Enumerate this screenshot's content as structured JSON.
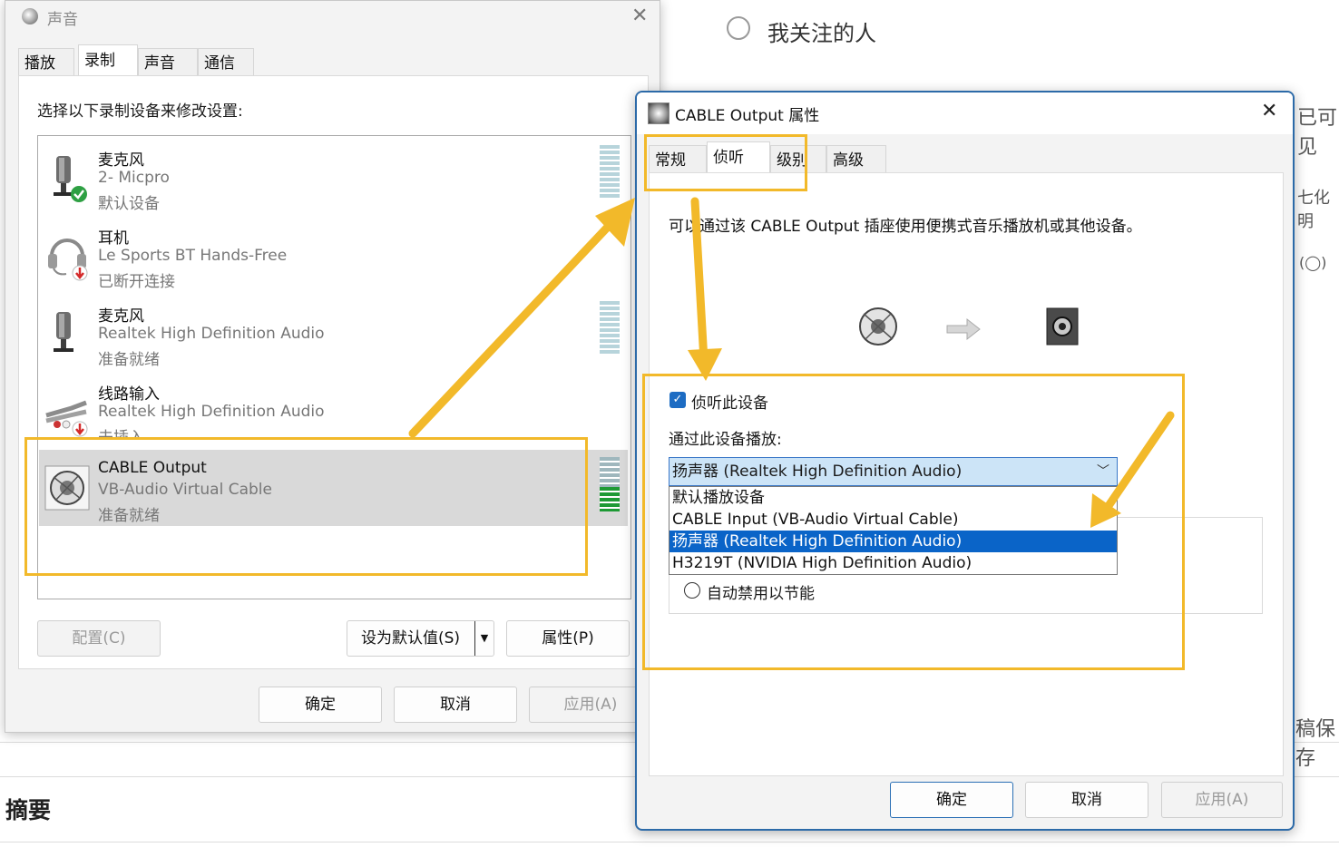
{
  "background": {
    "follow_label": "我关注的人",
    "right_fragments": [
      "已可见",
      "七化明",
      "(◯)",
      "稿保存"
    ],
    "summary_heading": "摘要"
  },
  "sound_dialog": {
    "title": "声音",
    "tabs": [
      "播放",
      "录制",
      "声音",
      "通信"
    ],
    "active_tab": "录制",
    "instruction": "选择以下录制设备来修改设置:",
    "devices": [
      {
        "name": "麦克风",
        "sub": "2- Micpro",
        "status": "默认设备",
        "icon": "microphone-icon",
        "badge": "default-check-badge"
      },
      {
        "name": "耳机",
        "sub": "Le Sports BT Hands-Free",
        "status": "已断开连接",
        "icon": "headset-icon",
        "badge": "disconnected-badge"
      },
      {
        "name": "麦克风",
        "sub": "Realtek High Definition Audio",
        "status": "准备就绪",
        "icon": "microphone-icon"
      },
      {
        "name": "线路输入",
        "sub": "Realtek High Definition Audio",
        "status": "未插入",
        "icon": "line-in-cable-icon",
        "badge": "unplugged-badge"
      },
      {
        "name": "CABLE Output",
        "sub": "VB-Audio Virtual Cable",
        "status": "准备就绪",
        "icon": "speaker-cable-icon",
        "level": 0.45
      }
    ],
    "buttons": {
      "configure": "配置(C)",
      "set_default": "设为默认值(S)",
      "properties": "属性(P)",
      "ok": "确定",
      "cancel": "取消",
      "apply": "应用(A)"
    }
  },
  "properties_dialog": {
    "title": "CABLE Output 属性",
    "tabs": [
      "常规",
      "侦听",
      "级别",
      "高级"
    ],
    "active_tab": "侦听",
    "description": "可以通过该 CABLE Output 插座使用便携式音乐播放机或其他设备。",
    "listen_checkbox": {
      "label": "侦听此设备",
      "checked": true
    },
    "playthrough_label": "通过此设备播放:",
    "selected_device": "扬声器 (Realtek High Definition Audio)",
    "dropdown_options": [
      "默认播放设备",
      "CABLE Input (VB-Audio Virtual Cable)",
      "扬声器 (Realtek High Definition Audio)",
      "H3219T (NVIDIA High Definition Audio)"
    ],
    "highlighted_option_index": 2,
    "power_radio_label": "自动禁用以节能",
    "buttons": {
      "ok": "确定",
      "cancel": "取消",
      "apply": "应用(A)"
    }
  },
  "annotation_color": "#f2b92a",
  "accent_color": "#0a64c8"
}
